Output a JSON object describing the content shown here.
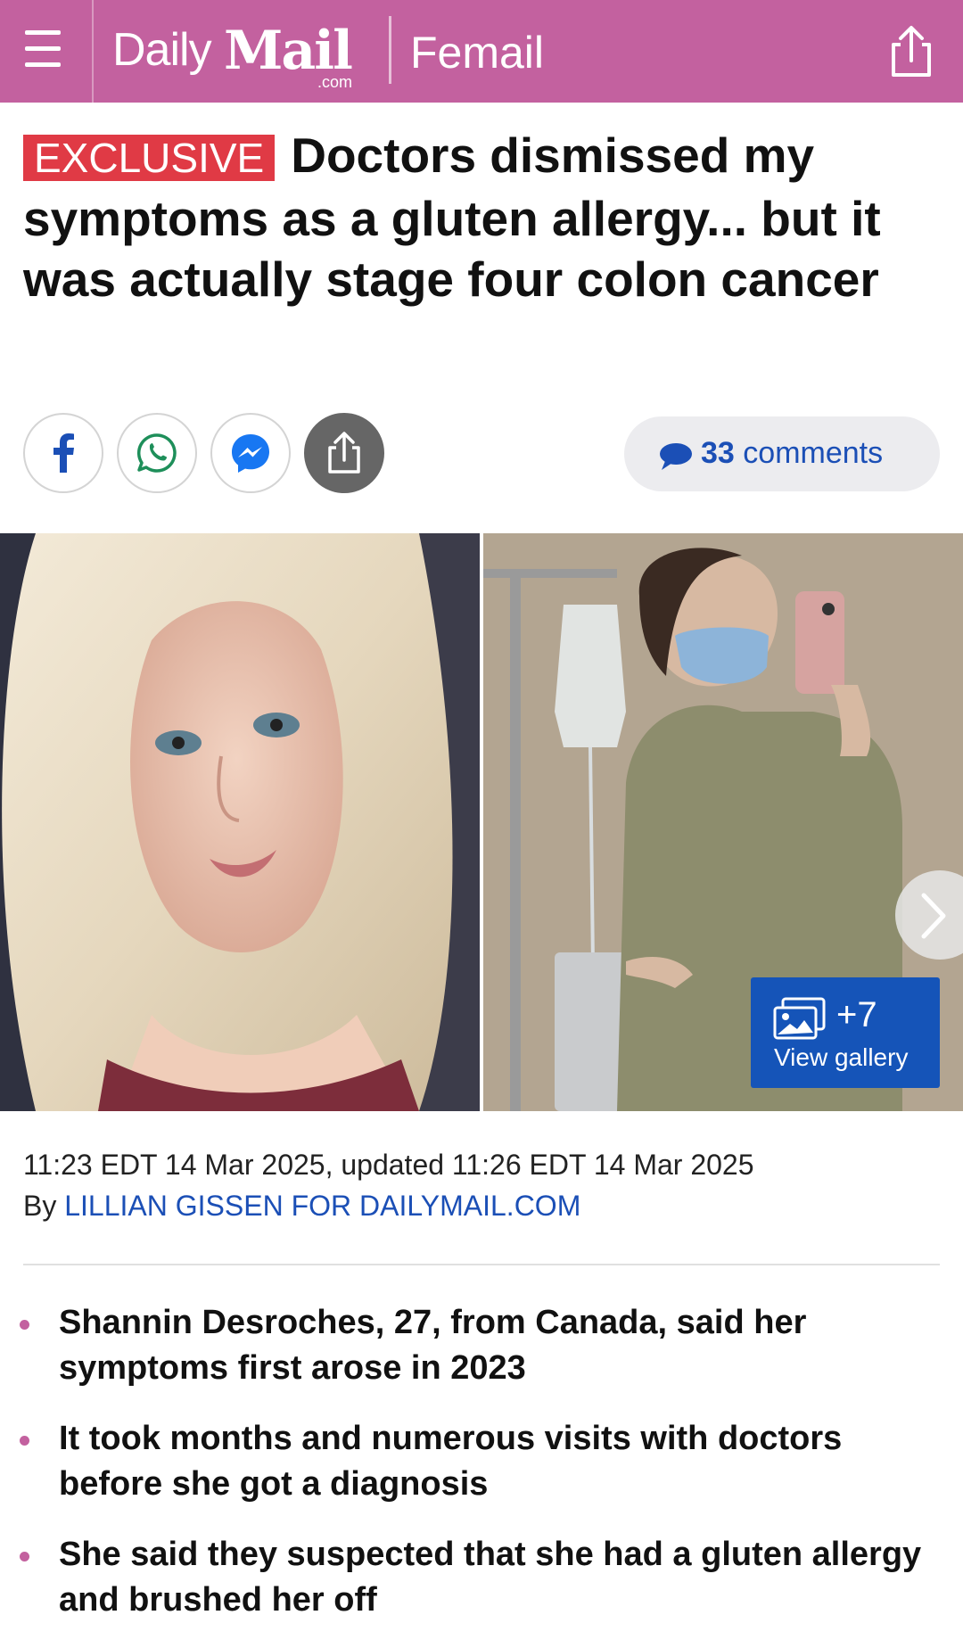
{
  "header": {
    "menu_icon": "hamburger-menu-icon",
    "logo_daily": "Daily",
    "logo_mail": "Mail",
    "logo_com": ".com",
    "section": "Femail",
    "share_icon": "share-icon",
    "background_color": "#c3619f"
  },
  "article": {
    "badge": "EXCLUSIVE",
    "badge_color": "#e03a45",
    "headline": "Doctors dismissed my symptoms as a gluten allergy... but it was actually stage four colon cancer",
    "share_buttons": [
      {
        "icon": "facebook-icon"
      },
      {
        "icon": "whatsapp-icon"
      },
      {
        "icon": "messenger-icon"
      },
      {
        "icon": "share-icon"
      }
    ],
    "comments": {
      "count": "33",
      "label": "comments",
      "icon": "comment-bubble-icon"
    },
    "gallery": {
      "count": "+7",
      "label": "View gallery",
      "icon": "gallery-icon",
      "next_icon": "chevron-right-icon"
    },
    "timestamp": "11:23 EDT 14 Mar 2025, updated 11:26 EDT 14 Mar 2025",
    "byline_prefix": "By",
    "author": "LILLIAN GISSEN FOR DAILYMAIL.COM",
    "bullets": [
      "Shannin Desroches, 27, from Canada, said her symptoms first arose in 2023",
      "It took months and numerous visits with doctors before she got a diagnosis",
      "She said they suspected that she had a gluten allergy and brushed her off"
    ]
  }
}
